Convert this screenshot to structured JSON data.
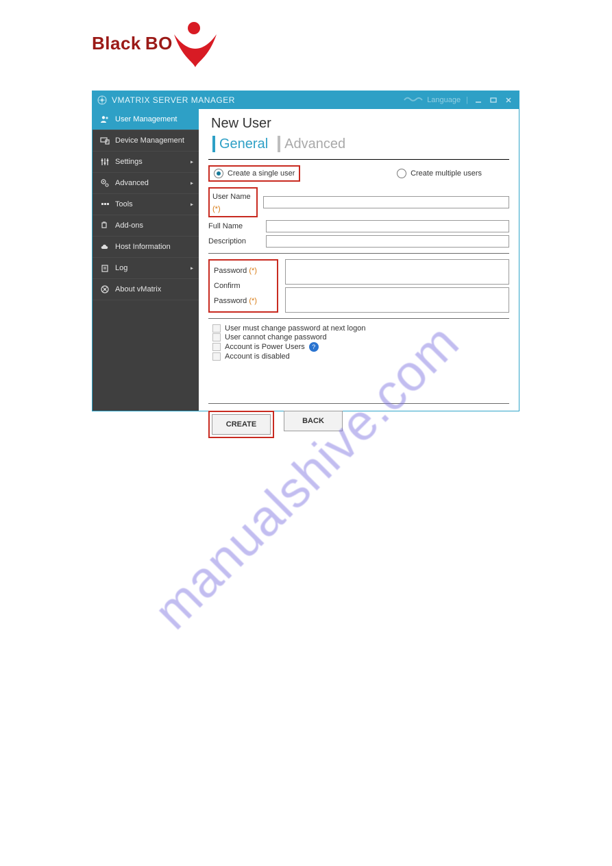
{
  "brand": {
    "part1": "Black",
    "part2": "BO"
  },
  "watermark": "manualshive.com",
  "window": {
    "title": "VMATRIX SERVER MANAGER",
    "language_label": "Language"
  },
  "sidebar": {
    "items": [
      {
        "label": "User Management",
        "icon": "users-icon",
        "active": true,
        "expandable": false
      },
      {
        "label": "Device Management",
        "icon": "devices-icon",
        "active": false,
        "expandable": false
      },
      {
        "label": "Settings",
        "icon": "sliders-icon",
        "active": false,
        "expandable": true
      },
      {
        "label": "Advanced",
        "icon": "gears-icon",
        "active": false,
        "expandable": true
      },
      {
        "label": "Tools",
        "icon": "tools-icon",
        "active": false,
        "expandable": true
      },
      {
        "label": "Add-ons",
        "icon": "plugin-icon",
        "active": false,
        "expandable": false
      },
      {
        "label": "Host Information",
        "icon": "cloud-icon",
        "active": false,
        "expandable": false
      },
      {
        "label": "Log",
        "icon": "log-icon",
        "active": false,
        "expandable": true
      },
      {
        "label": "About vMatrix",
        "icon": "info-icon",
        "active": false,
        "expandable": false
      }
    ]
  },
  "main": {
    "title": "New User",
    "tabs": {
      "general": "General",
      "advanced": "Advanced"
    },
    "radios": {
      "single": "Create a single user",
      "multiple": "Create multiple users"
    },
    "fields": {
      "username": "User Name",
      "fullname": "Full Name",
      "description": "Description",
      "password": "Password",
      "confirm_password": "Confirm Password",
      "required_marker": "(*)"
    },
    "checks": {
      "must_change": "User must change password at next logon",
      "cannot_change": "User cannot change password",
      "power_users": "Account is Power Users",
      "disabled": "Account is disabled"
    },
    "buttons": {
      "create": "CREATE",
      "back": "BACK"
    }
  }
}
